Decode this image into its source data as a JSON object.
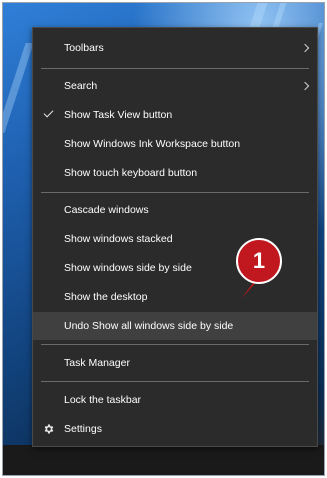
{
  "menu": {
    "items": [
      {
        "label": "Toolbars",
        "submenu": true
      },
      {
        "label": "Search",
        "submenu": true
      },
      {
        "label": "Show Task View button",
        "checked": true
      },
      {
        "label": "Show Windows Ink Workspace button"
      },
      {
        "label": "Show touch keyboard button"
      },
      {
        "label": "Cascade windows"
      },
      {
        "label": "Show windows stacked"
      },
      {
        "label": "Show windows side by side"
      },
      {
        "label": "Show the desktop"
      },
      {
        "label": "Undo Show all windows side by side",
        "highlighted": true
      },
      {
        "label": "Task Manager"
      },
      {
        "label": "Lock the taskbar"
      },
      {
        "label": "Settings",
        "icon": "gear-icon"
      }
    ]
  },
  "callout": {
    "number": "1",
    "color": "#c0181e"
  },
  "colors": {
    "menu_bg": "#2b2b2b",
    "highlight_bg": "#404040",
    "separator": "#6a6a6a"
  }
}
